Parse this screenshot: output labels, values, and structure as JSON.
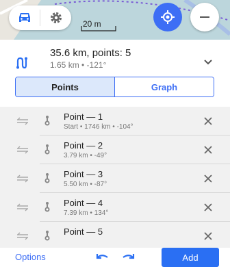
{
  "map": {
    "scale_label": "20 m",
    "buttons": [
      "car-icon",
      "gear-icon",
      "my-location-icon",
      "zoom-out-icon"
    ]
  },
  "summary": {
    "title": "35.6 km, points: 5",
    "subtitle": "1.65 km • -121°"
  },
  "tabs": [
    {
      "label": "Points",
      "active": true
    },
    {
      "label": "Graph",
      "active": false
    }
  ],
  "points": [
    {
      "name": "Point — 1",
      "meta": "Start  •  1746 km  •  -104°"
    },
    {
      "name": "Point — 2",
      "meta": "3.79 km  •  -49°"
    },
    {
      "name": "Point — 3",
      "meta": "5.50 km  •  -87°"
    },
    {
      "name": "Point — 4",
      "meta": "7.39 km  •  134°"
    },
    {
      "name": "Point — 5",
      "meta": ""
    }
  ],
  "bottom": {
    "options_label": "Options",
    "add_label": "Add"
  },
  "colors": {
    "accent": "#3d6ef5",
    "map_water": "#bcd6dc"
  }
}
